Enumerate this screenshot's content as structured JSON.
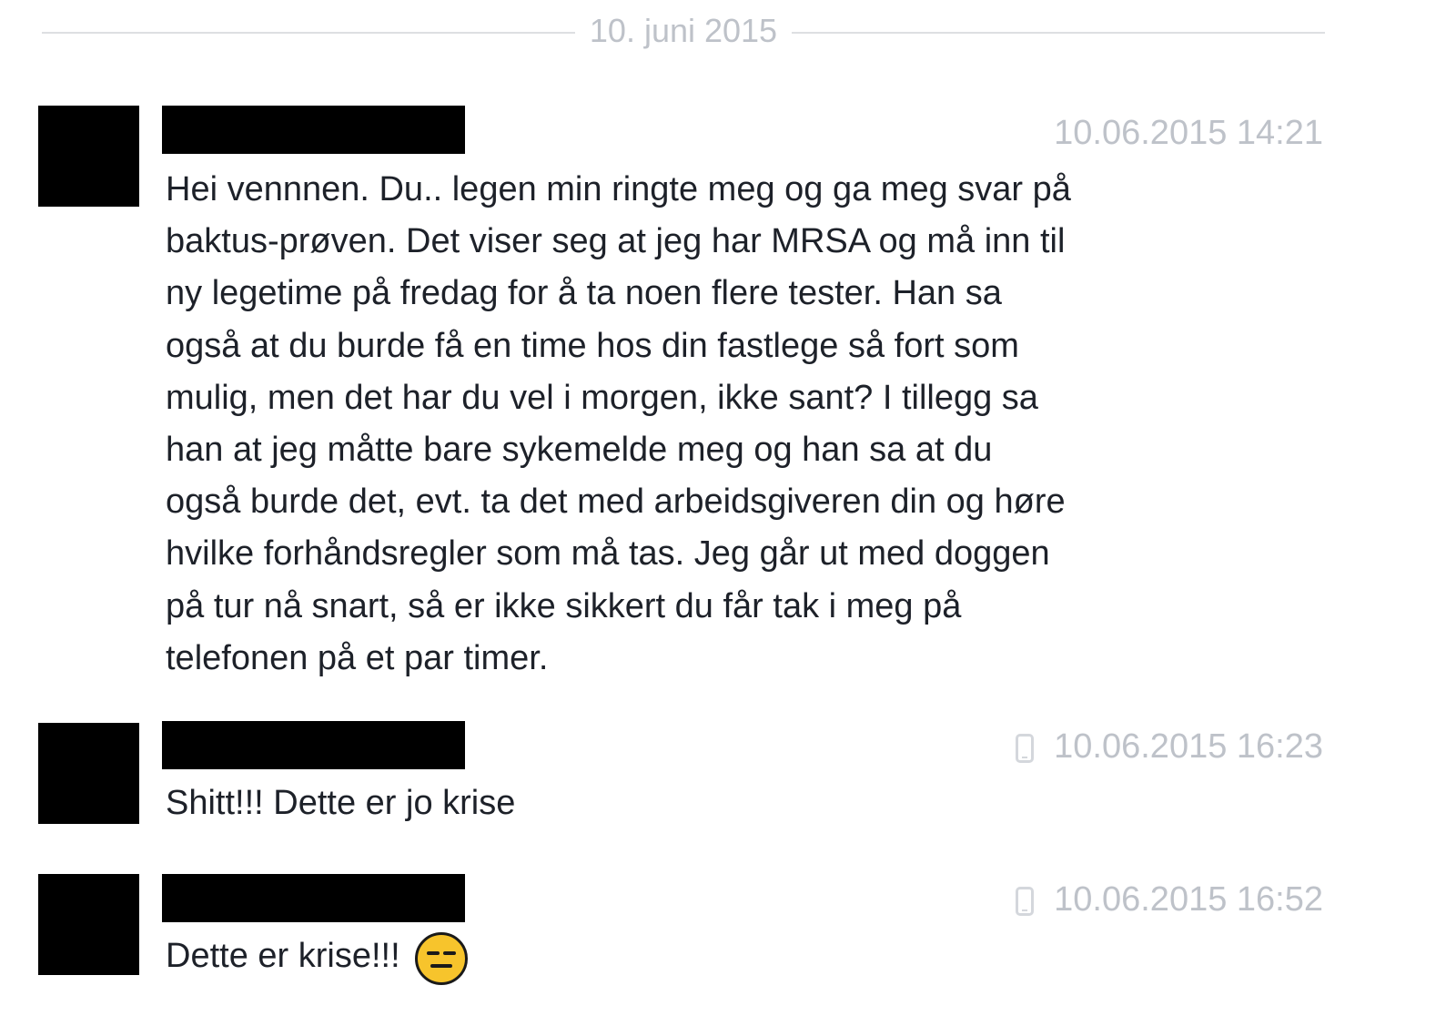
{
  "date_divider": {
    "label": "10. juni 2015"
  },
  "messages": [
    {
      "timestamp": "10.06.2015 14:21",
      "device_icon": null,
      "lines": [
        "Hei vennnen. Du.. legen min ringte meg og ga meg svar på",
        "baktus-prøven. Det viser seg at jeg har MRSA og må inn til",
        "ny legetime på fredag for å ta noen flere tester. Han sa",
        "også at du burde få en time hos din fastlege så fort som",
        "mulig, men det har du vel i morgen, ikke sant? I tillegg sa",
        "han at jeg måtte bare sykemelde meg og han sa at du",
        "også burde det, evt. ta det med arbeidsgiveren din og høre",
        "hvilke forhåndsregler som må tas. Jeg går ut med doggen",
        "på tur nå snart, så er ikke sikkert du får tak i meg på",
        "telefonen på et par timer."
      ]
    },
    {
      "timestamp": "10.06.2015 16:23",
      "device_icon": "mobile-phone-icon",
      "text": "Shitt!!! Dette er jo krise"
    },
    {
      "timestamp": "10.06.2015 16:52",
      "device_icon": "mobile-phone-icon",
      "text": "Dette er krise!!!",
      "emoji": "neutral-face-emoji"
    }
  ],
  "colors": {
    "text": "#1d2129",
    "meta": "#bec2c9",
    "divider": "#dddfe2",
    "redaction": "#000000",
    "emoji": "#f7c42c"
  }
}
